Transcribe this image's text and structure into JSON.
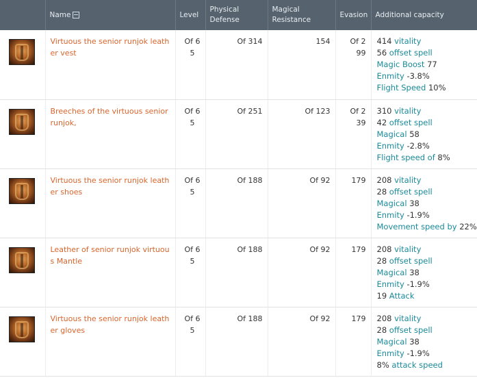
{
  "header": {
    "name": "Name",
    "level": "Level",
    "physical_defense": "Physical Defense",
    "magical_resistance": "Magical Resistance",
    "evasion": "Evasion",
    "additional_capacity": "Additional capacity"
  },
  "rows": [
    {
      "icon": "leather-vest-icon",
      "name": "Virtuous the senior runjok leather vest",
      "level": "Of 65",
      "physical_defense": "Of 314",
      "magical_resistance": "154",
      "evasion": "Of 299",
      "capacity": [
        {
          "value": "414",
          "stat": "vitality",
          "after": ""
        },
        {
          "value": "56",
          "stat": "offset spell",
          "after": ""
        },
        {
          "value": "",
          "stat": "Magic Boost",
          "after": "77"
        },
        {
          "value": "",
          "stat": "Enmity",
          "after": "-3.8%"
        },
        {
          "value": "",
          "stat": "Flight Speed",
          "after": "10%"
        }
      ]
    },
    {
      "icon": "leather-breeches-icon",
      "name": "Breeches of the virtuous senior runjok,",
      "level": "Of 65",
      "physical_defense": "Of 251",
      "magical_resistance": "Of 123",
      "evasion": "Of 239",
      "capacity": [
        {
          "value": "310",
          "stat": "vitality",
          "after": ""
        },
        {
          "value": "42",
          "stat": "offset spell",
          "after": ""
        },
        {
          "value": "",
          "stat": "Magical",
          "after": "58"
        },
        {
          "value": "",
          "stat": "Enmity",
          "after": "-2.8%"
        },
        {
          "value": "",
          "stat": "Flight speed of",
          "after": "8%"
        }
      ]
    },
    {
      "icon": "leather-shoes-icon",
      "name": "Virtuous the senior runjok leather shoes",
      "level": "Of 65",
      "physical_defense": "Of 188",
      "magical_resistance": "Of 92",
      "evasion": "179",
      "capacity": [
        {
          "value": "208",
          "stat": "vitality",
          "after": ""
        },
        {
          "value": "28",
          "stat": "offset spell",
          "after": ""
        },
        {
          "value": "",
          "stat": "Magical",
          "after": "38"
        },
        {
          "value": "",
          "stat": "Enmity",
          "after": "-1.9%"
        },
        {
          "value": "",
          "stat": "Movement speed by",
          "after": "22%"
        }
      ]
    },
    {
      "icon": "leather-mantle-icon",
      "name": "Leather of senior runjok virtuous Mantle",
      "level": "Of 65",
      "physical_defense": "Of 188",
      "magical_resistance": "Of 92",
      "evasion": "179",
      "capacity": [
        {
          "value": "208",
          "stat": "vitality",
          "after": ""
        },
        {
          "value": "28",
          "stat": "offset spell",
          "after": ""
        },
        {
          "value": "",
          "stat": "Magical",
          "after": "38"
        },
        {
          "value": "",
          "stat": "Enmity",
          "after": "-1.9%"
        },
        {
          "value": "19",
          "stat": "Attack",
          "after": ""
        }
      ]
    },
    {
      "icon": "leather-gloves-icon",
      "name": "Virtuous the senior runjok leather gloves",
      "level": "Of 65",
      "physical_defense": "Of 188",
      "magical_resistance": "Of 92",
      "evasion": "179",
      "capacity": [
        {
          "value": "208",
          "stat": "vitality",
          "after": ""
        },
        {
          "value": "28",
          "stat": "offset spell",
          "after": ""
        },
        {
          "value": "",
          "stat": "Magical",
          "after": "38"
        },
        {
          "value": "",
          "stat": "Enmity",
          "after": "-1.9%"
        },
        {
          "value": "8%",
          "stat": "attack speed",
          "after": ""
        }
      ]
    }
  ]
}
